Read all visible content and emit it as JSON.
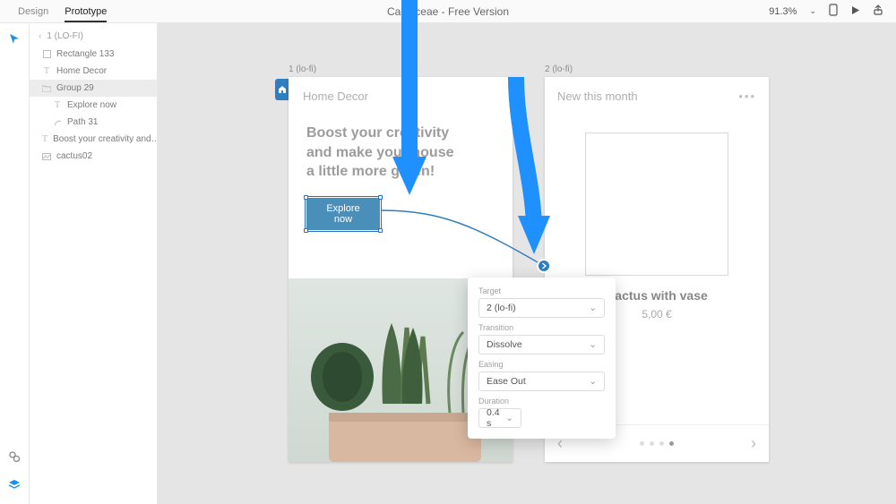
{
  "toolbar": {
    "tabs": {
      "design": "Design",
      "prototype": "Prototype"
    },
    "title": "Cactaceae - Free Version",
    "zoom": "91.3%"
  },
  "layers": {
    "breadcrumb": "1 (LO-FI)",
    "items": [
      {
        "icon": "rect",
        "label": "Rectangle 133"
      },
      {
        "icon": "text",
        "label": "Home Decor"
      },
      {
        "icon": "folder",
        "label": "Group 29",
        "selected": true
      },
      {
        "icon": "text",
        "label": "Explore now",
        "indent": 1
      },
      {
        "icon": "path",
        "label": "Path 31",
        "indent": 1
      },
      {
        "icon": "text",
        "label": "Boost your creativity and…"
      },
      {
        "icon": "image",
        "label": "cactus02"
      }
    ]
  },
  "artboards": {
    "a1": {
      "label": "1 (lo-fi)",
      "header": "Home Decor",
      "headline_l1": "Boost your creativity",
      "headline_l2": "and make your house",
      "headline_l3": "a little more green!",
      "cta": "Explore now"
    },
    "a2": {
      "label": "2 (lo-fi)",
      "header": "New this month",
      "card_title": "Cactus with vase",
      "card_price": "5,00 €"
    }
  },
  "popover": {
    "target_label": "Target",
    "target_value": "2 (lo-fi)",
    "transition_label": "Transition",
    "transition_value": "Dissolve",
    "easing_label": "Easing",
    "easing_value": "Ease Out",
    "duration_label": "Duration",
    "duration_value": "0.4 s"
  }
}
